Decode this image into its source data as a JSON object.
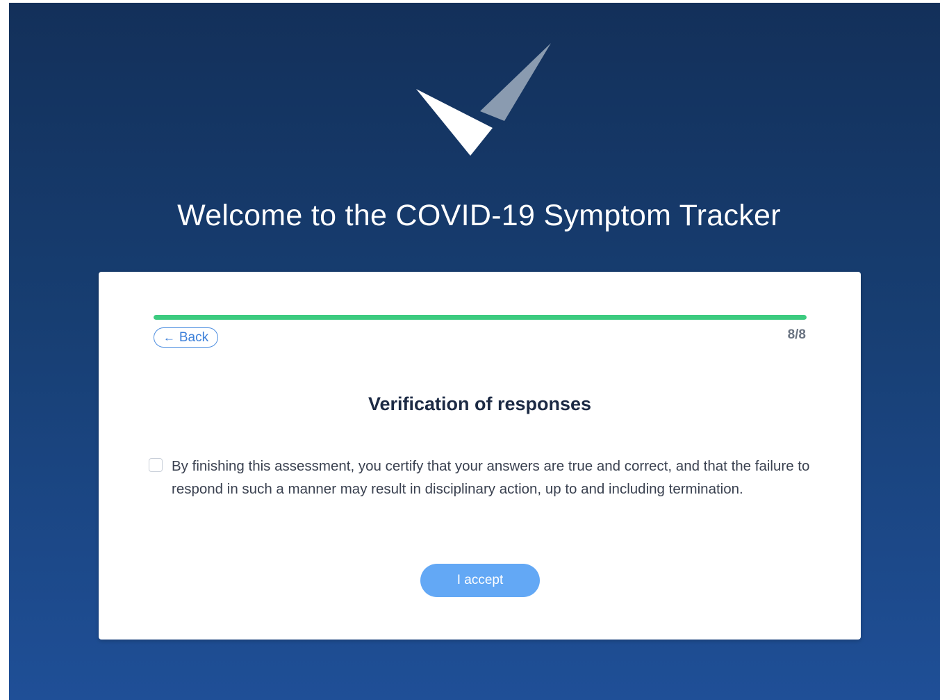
{
  "header": {
    "title": "Welcome to the COVID-19 Symptom Tracker",
    "logo_icon": "checkmark-logo-icon"
  },
  "progress": {
    "fraction": 1.0,
    "step_label": "8/8",
    "color": "#3ccb7f"
  },
  "navigation": {
    "back_icon": "arrow-left-icon",
    "back_arrow": "←",
    "back_label": "Back"
  },
  "section": {
    "heading": "Verification of responses"
  },
  "certification": {
    "checked": false,
    "text": "By finishing this assessment, you certify that your answers are true and correct, and that the failure to respond in such a manner may result in disciplinary action, up to and including termination."
  },
  "actions": {
    "accept_label": "I accept",
    "accept_color": "#63a8f5"
  },
  "colors": {
    "background_top": "#13305a",
    "background_bottom": "#1f4f97",
    "card": "#ffffff",
    "heading": "#1c2a44"
  }
}
